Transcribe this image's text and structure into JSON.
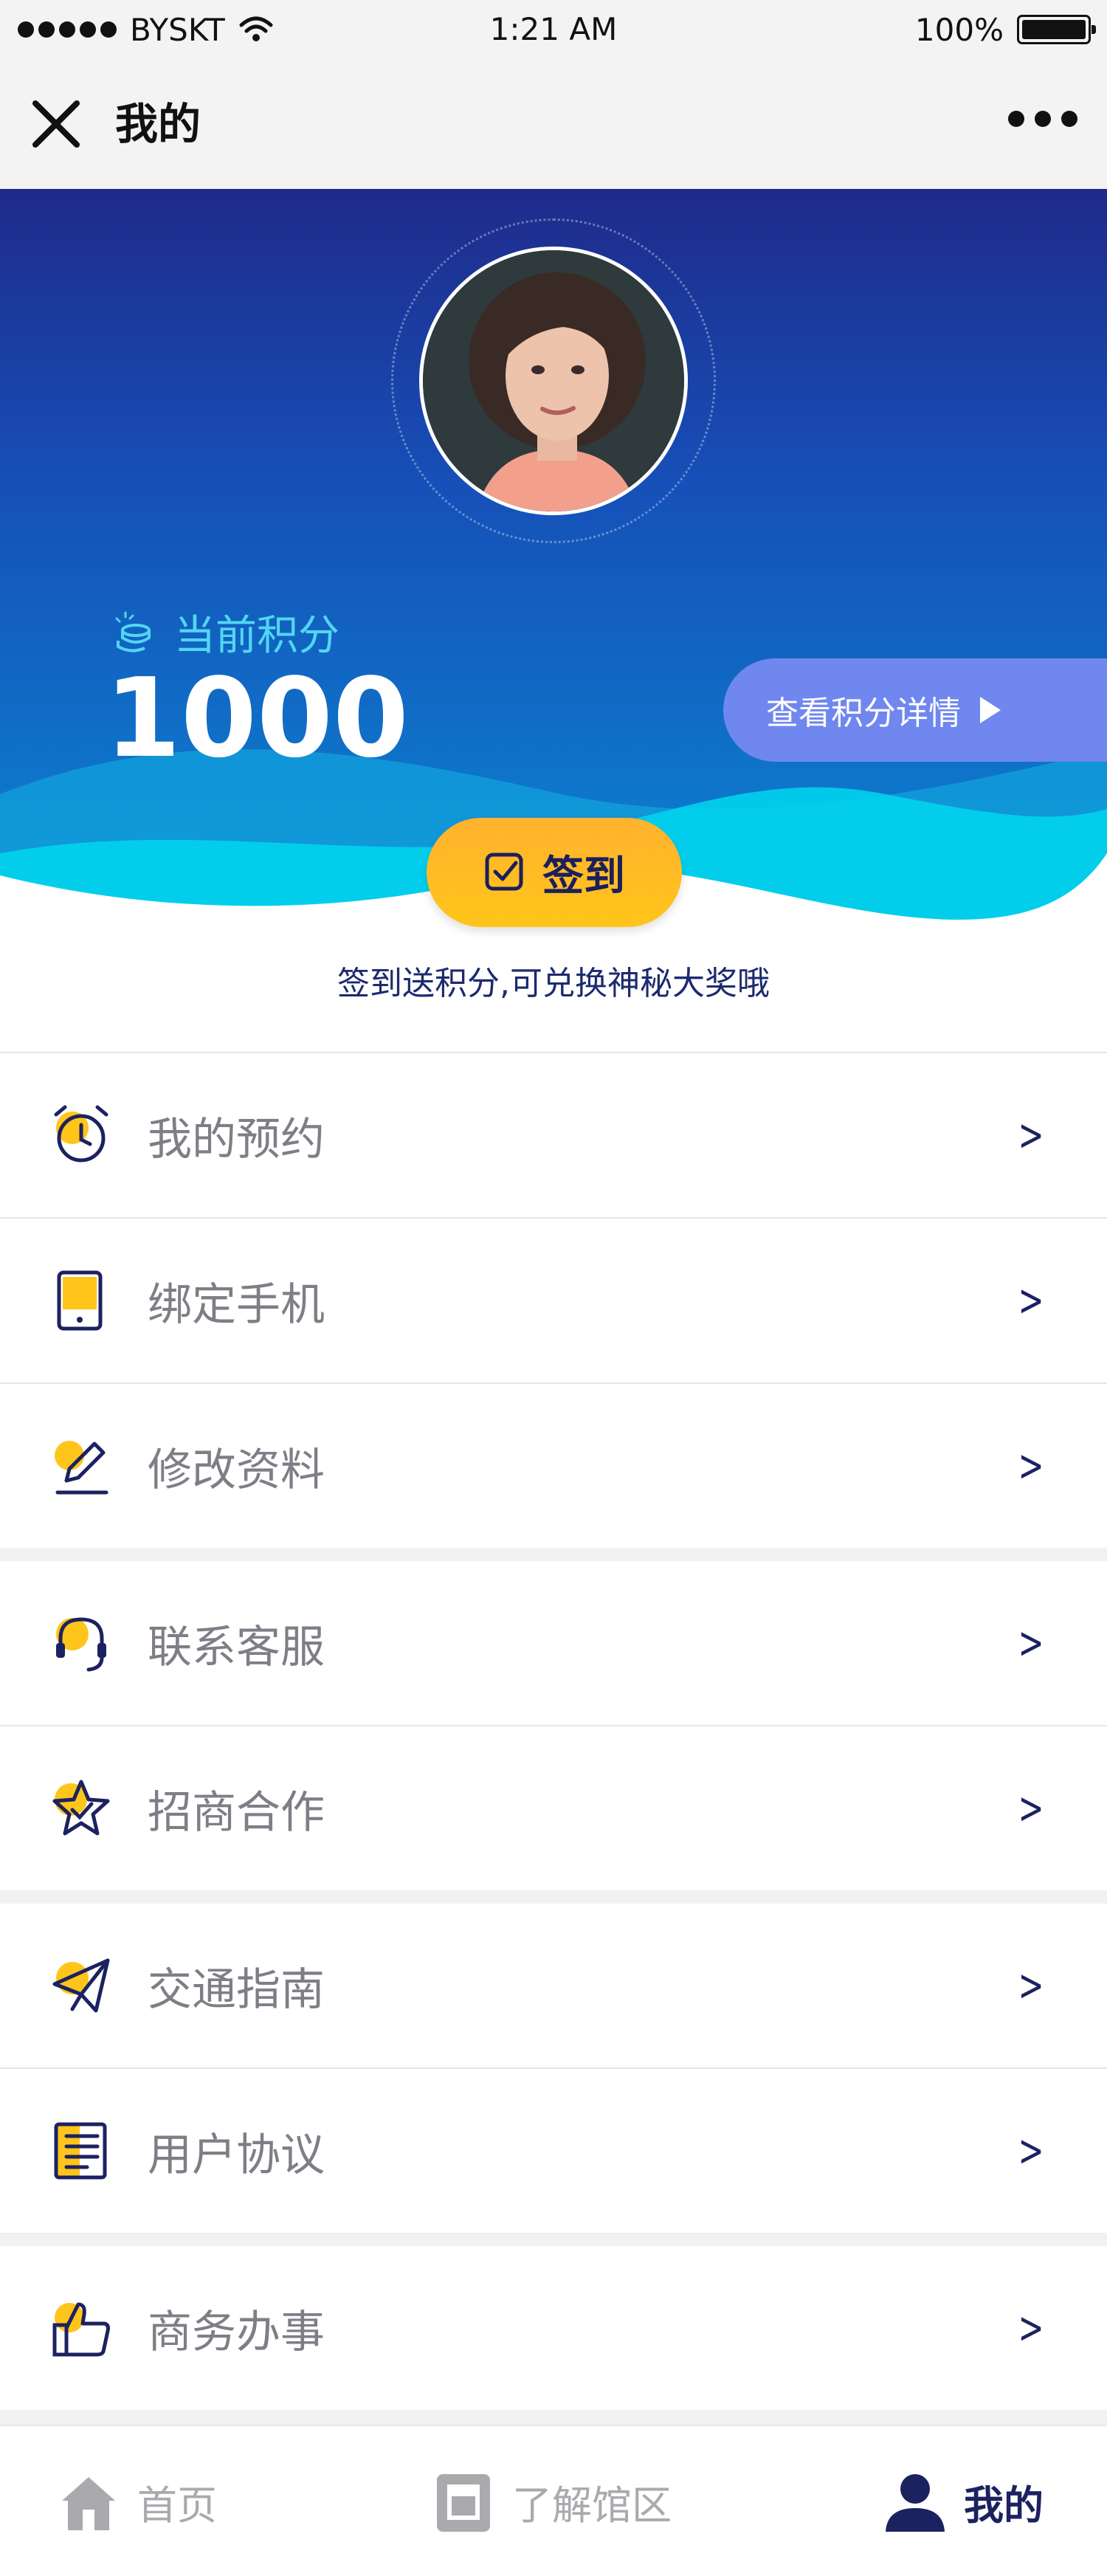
{
  "status_bar": {
    "carrier": "BYSKT",
    "time": "1:21 AM",
    "battery": "100%"
  },
  "nav": {
    "title": "我的",
    "close_icon": "close-icon",
    "more_icon": "more-icon"
  },
  "hero": {
    "points_label": "当前积分",
    "points_value": "1000",
    "detail_button": "查看积分详情",
    "checkin_button": "签到",
    "checkin_tip": "签到送积分,可兑换神秘大奖哦"
  },
  "menu": [
    {
      "label": "我的预约",
      "icon": "alarm-clock-icon"
    },
    {
      "label": "绑定手机",
      "icon": "phone-icon"
    },
    {
      "label": "修改资料",
      "icon": "edit-icon"
    },
    {
      "label": "联系客服",
      "icon": "headset-icon"
    },
    {
      "label": "招商合作",
      "icon": "star-icon"
    },
    {
      "label": "交通指南",
      "icon": "paper-plane-icon"
    },
    {
      "label": "用户协议",
      "icon": "document-list-icon"
    },
    {
      "label": "商务办事",
      "icon": "thumbs-up-icon"
    }
  ],
  "tabs": [
    {
      "label": "首页",
      "icon": "home-icon",
      "active": false
    },
    {
      "label": "了解馆区",
      "icon": "book-icon",
      "active": false
    },
    {
      "label": "我的",
      "icon": "user-icon",
      "active": true
    }
  ],
  "colors": {
    "accent": "#1c2260",
    "yellow": "#ffc51a",
    "hero_top": "#1f2a8a",
    "hero_bottom": "#0b86d2",
    "cyan": "#00d7ee"
  }
}
